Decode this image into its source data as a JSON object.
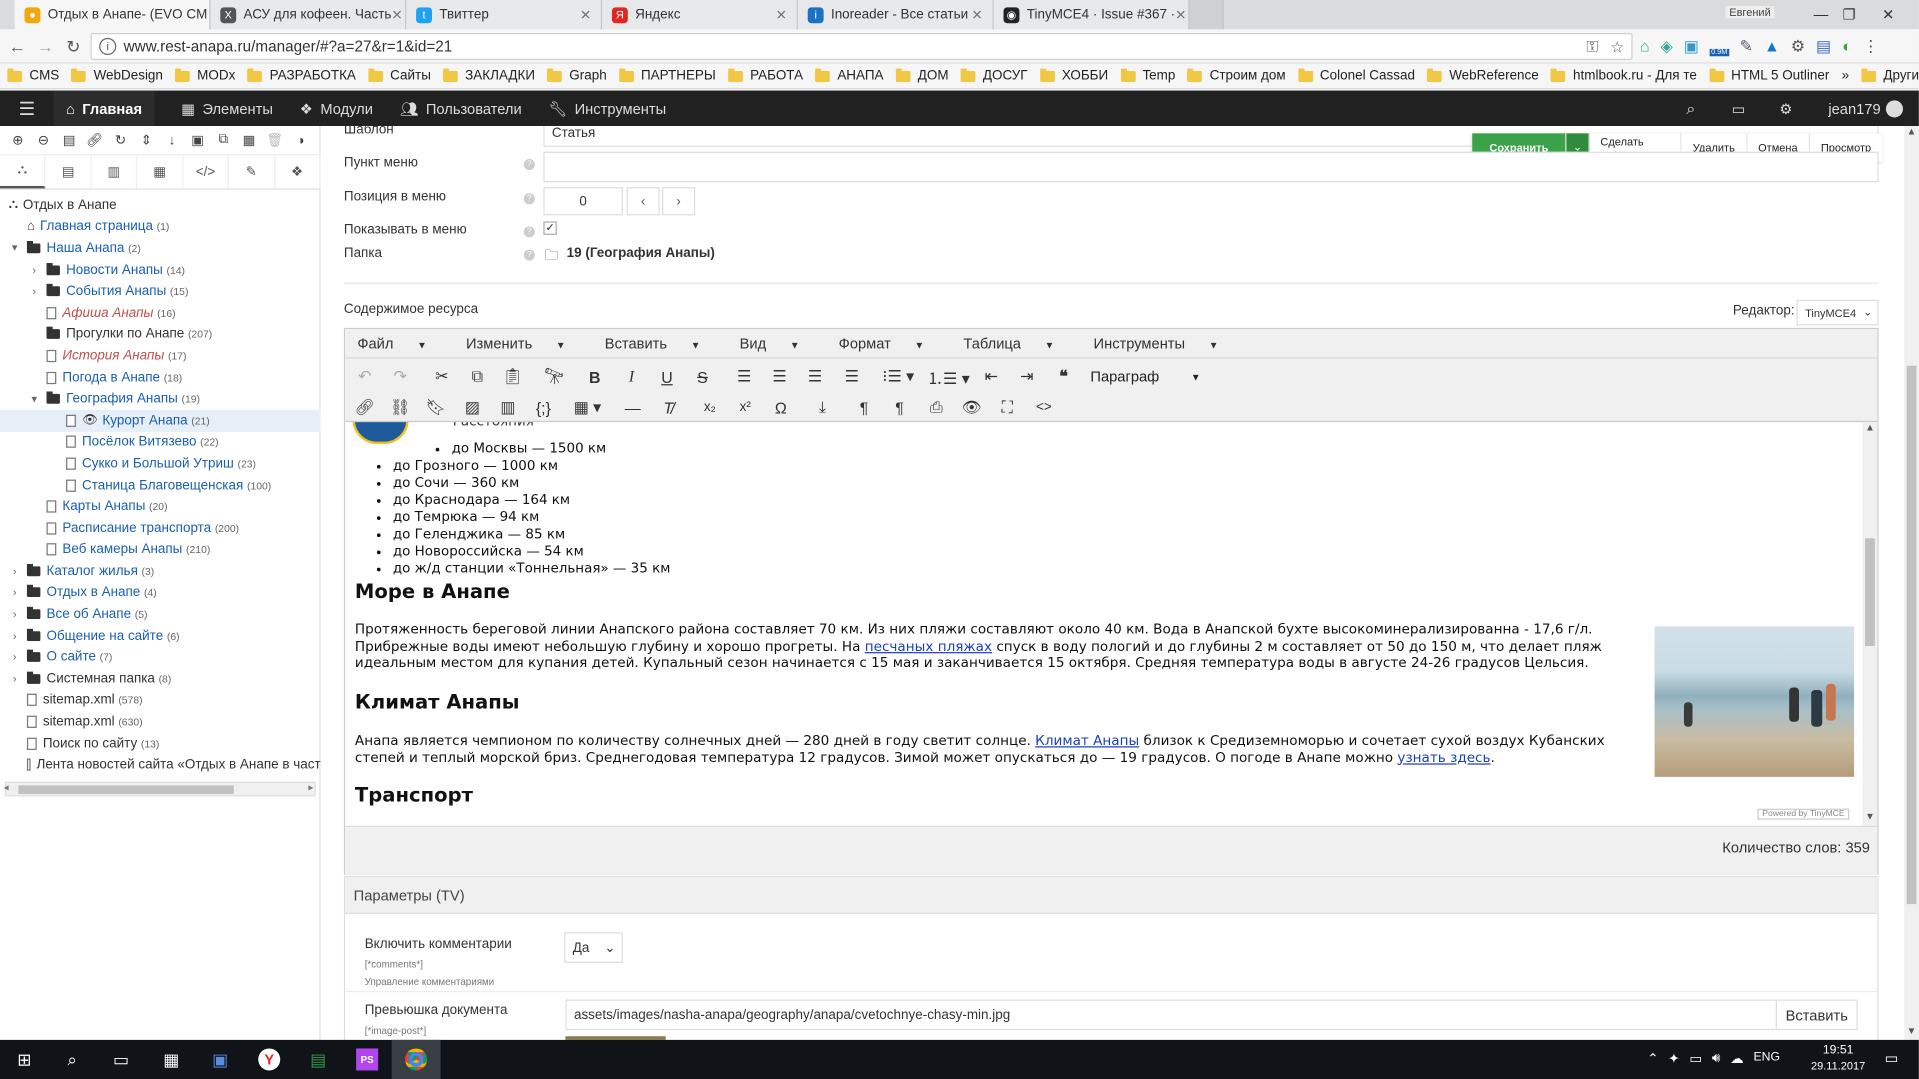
{
  "browser": {
    "tabs": [
      {
        "title": "Отдых в Анапе- (EVO CM",
        "color": "#f2a60c",
        "glyph": "●",
        "active": true
      },
      {
        "title": "АСУ для кофеен. Часть",
        "color": "#555555",
        "glyph": "X"
      },
      {
        "title": "Твиттер",
        "color": "#1da1f2",
        "glyph": "t"
      },
      {
        "title": "Яндекс",
        "color": "#e52620",
        "glyph": "Я"
      },
      {
        "title": "Inoreader - Все статьи",
        "color": "#1b72c4",
        "glyph": "i"
      },
      {
        "title": "TinyMCE4 · Issue #367 ·",
        "color": "#222222",
        "glyph": "◉"
      }
    ],
    "user": "Евгений",
    "url": "www.rest-anapa.ru/manager/#?a=27&r=1&id=21",
    "bookmarks": [
      "CMS",
      "WebDesign",
      "MODx",
      "РАЗРАБОТКА",
      "Сайты",
      "ЗАКЛАДКИ",
      "Graph",
      "ПАРТНЕРЫ",
      "РАБОТА",
      "АНАПА",
      "ДОМ",
      "ДОСУГ",
      "ХОББИ",
      "Temp",
      "Строим дом",
      "Colonel Cassad",
      "WebReference",
      "htmlbook.ru - Для те",
      "HTML 5 Outliner"
    ],
    "other_bookmarks": "Другие закладки",
    "ext_badge": "0.9M"
  },
  "manager": {
    "menu": [
      "Главная",
      "Элементы",
      "Модули",
      "Пользователи",
      "Инструменты"
    ],
    "username": "jean179"
  },
  "tree": {
    "root": "Отдых в Анапе",
    "items": [
      {
        "label": "Главная страница",
        "count": "(1)",
        "indent": 1,
        "type": "home"
      },
      {
        "label": "Наша Анапа",
        "count": "(2)",
        "indent": 1,
        "type": "folder-open",
        "arrow": "▾"
      },
      {
        "label": "Новости Анапы",
        "count": "(14)",
        "indent": 2,
        "type": "folder",
        "arrow": "›"
      },
      {
        "label": "События Анапы",
        "count": "(15)",
        "indent": 2,
        "type": "folder",
        "arrow": "›"
      },
      {
        "label": "Афиша Анапы",
        "count": "(16)",
        "indent": 2,
        "type": "doc",
        "dim": true
      },
      {
        "label": "Прогулки по Анапе",
        "count": "(207)",
        "indent": 2,
        "type": "folder",
        "plain": true
      },
      {
        "label": "История Анапы",
        "count": "(17)",
        "indent": 2,
        "type": "doc",
        "dim": true
      },
      {
        "label": "Погода в Анапе",
        "count": "(18)",
        "indent": 2,
        "type": "doc"
      },
      {
        "label": "География Анапы",
        "count": "(19)",
        "indent": 2,
        "type": "folder-open",
        "arrow": "▾"
      },
      {
        "label": "Курорт Анапа",
        "count": "(21)",
        "indent": 3,
        "type": "doc",
        "selected": true
      },
      {
        "label": "Посёлок Витязево",
        "count": "(22)",
        "indent": 3,
        "type": "doc"
      },
      {
        "label": "Сукко и Большой Утриш",
        "count": "(23)",
        "indent": 3,
        "type": "doc"
      },
      {
        "label": "Станица Благовещенская",
        "count": "(100)",
        "indent": 3,
        "type": "doc"
      },
      {
        "label": "Карты Анапы",
        "count": "(20)",
        "indent": 2,
        "type": "doc"
      },
      {
        "label": "Расписание транспорта",
        "count": "(200)",
        "indent": 2,
        "type": "doc"
      },
      {
        "label": "Веб камеры Анапы",
        "count": "(210)",
        "indent": 2,
        "type": "doc"
      },
      {
        "label": "Каталог жилья",
        "count": "(3)",
        "indent": 1,
        "type": "folder",
        "arrow": "›"
      },
      {
        "label": "Отдых в Анапе",
        "count": "(4)",
        "indent": 1,
        "type": "folder",
        "arrow": "›"
      },
      {
        "label": "Все об Анапе",
        "count": "(5)",
        "indent": 1,
        "type": "folder",
        "arrow": "›"
      },
      {
        "label": "Общение на сайте",
        "count": "(6)",
        "indent": 1,
        "type": "folder",
        "arrow": "›"
      },
      {
        "label": "О сайте",
        "count": "(7)",
        "indent": 1,
        "type": "folder",
        "arrow": "›"
      },
      {
        "label": "Системная папка",
        "count": "(8)",
        "indent": 1,
        "type": "folder",
        "arrow": "›",
        "plain": true
      },
      {
        "label": "sitemap.xml",
        "count": "(578)",
        "indent": 1,
        "type": "doc",
        "plain": true
      },
      {
        "label": "sitemap.xml",
        "count": "(630)",
        "indent": 1,
        "type": "doc",
        "plain": true
      },
      {
        "label": "Поиск по сайту",
        "count": "(13)",
        "indent": 1,
        "type": "doc",
        "plain": true
      },
      {
        "label": "Лента новостей сайта «Отдых в Анапе в част",
        "count": "",
        "indent": 1,
        "type": "doc",
        "plain": true
      }
    ]
  },
  "form": {
    "template_label": "Шаблон",
    "template_value": "Статья",
    "menu_item_label": "Пункт меню",
    "menu_pos_label": "Позиция в меню",
    "menu_pos_value": "0",
    "show_menu_label": "Показывать в меню",
    "folder_label": "Папка",
    "folder_value": "19 (География Анапы)",
    "content_label": "Содержимое ресурса",
    "editor_label": "Редактор:",
    "editor_value": "TinyMCE4"
  },
  "actions": {
    "save": "Сохранить",
    "copy": "Сделать копию",
    "delete": "Удалить",
    "cancel": "Отмена",
    "preview": "Просмотр"
  },
  "editor": {
    "menu": [
      "Файл",
      "Изменить",
      "Вставить",
      "Вид",
      "Формат",
      "Таблица",
      "Инструменты"
    ],
    "paragraph": "Параграф",
    "partial_line": "Расстояния",
    "list_nested": "до Москвы — 1500 км",
    "list": [
      "до Грозного — 1000 км",
      "до Сочи — 360 км",
      "до Краснодара — 164 км",
      "до Темрюка — 94 км",
      "до Геленджика — 85 км",
      "до Новороссийска — 54 км",
      "до ж/д станции «Тоннельная» — 35 км"
    ],
    "h_sea": "Море в Анапе",
    "sea_p1": "Протяженность береговой линии Анапского района составляет 70 км. Из них пляжи составляют около 40 км. Вода в Анапской бухте высокоминерализированна - 17,6 г/л. Прибрежные воды имеют небольшую глубину и хорошо прогреты. На ",
    "sea_link": "песчаных пляжах",
    "sea_p2": " спуск в воду пологий и до глубины 2 м составляет от 50 до 150 м, что делает пляж идеальным местом для купания детей. Купальный сезон начинается с 15 мая и заканчивается 15 октября. Средняя температура воды в августе 24-26 градусов Цельсия.",
    "h_climate": "Климат Анапы",
    "cl_p1": "Анапа является чемпионом по количеству солнечных дней — 280 дней в году светит солнце. ",
    "cl_link": "Климат Анапы",
    "cl_p2": " близок к Средиземноморью и сочетает сухой воздух Кубанских степей и теплый морской бриз. Среднегодовая температура 12 градусов. Зимой может опускаться до — 19 градусов. О погоде в Анапе можно ",
    "cl_link2": "узнать здесь",
    "cl_p3": ".",
    "h_transport": "Транспорт",
    "powered": "Powered by TinyMCE",
    "wordcount": "Количество слов: 359"
  },
  "tv": {
    "header": "Параметры (TV)",
    "comments_label": "Включить комментарии",
    "comments_key": "[*comments*]",
    "comments_desc": "Управление комментариями",
    "comments_value": "Да",
    "thumb_label": "Превьюшка документа",
    "thumb_key": "[*image-post*]",
    "thumb_value": "assets/images/nasha-anapa/geography/anapa/cvetochnye-chasy-min.jpg",
    "insert": "Вставить"
  },
  "taskbar": {
    "lang": "ENG",
    "time": "19:51",
    "date": "29.11.2017"
  }
}
